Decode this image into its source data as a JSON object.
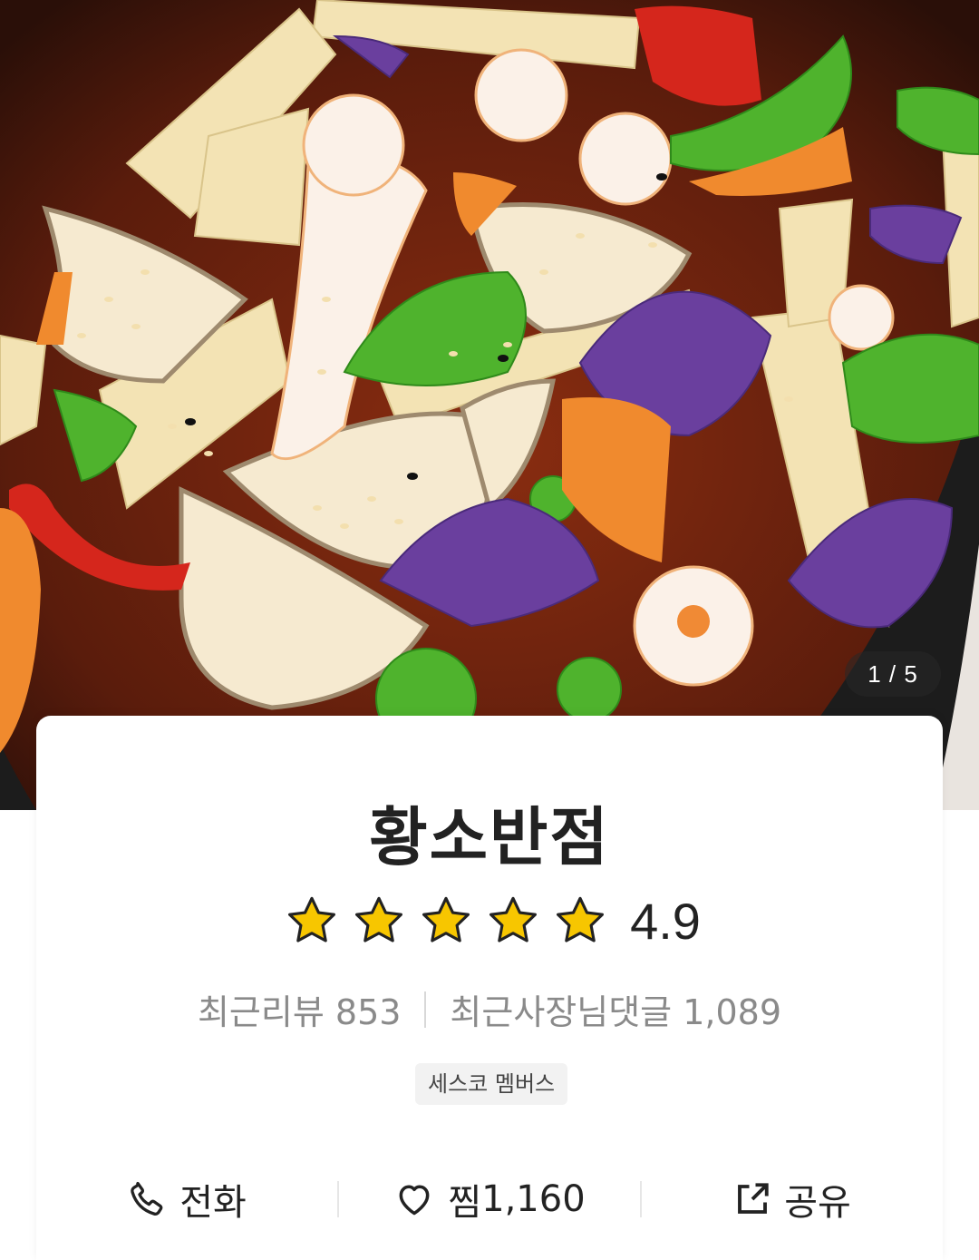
{
  "gallery": {
    "current_index": 1,
    "total": 5,
    "pager_text": "1 / 5"
  },
  "restaurant": {
    "name": "황소반점",
    "rating": 4.9,
    "rating_text": "4.9",
    "stars_filled": 5,
    "stars_total": 5,
    "recent_reviews_label": "최근리뷰 853",
    "owner_comments_label": "최근사장님댓글 1,089",
    "badge": "세스코 멤버스"
  },
  "actions": {
    "call_label": "전화",
    "like_label": "찜",
    "like_count": "1,160",
    "share_label": "공유"
  },
  "colors": {
    "star": "#f7c600",
    "text_primary": "#222222",
    "text_secondary": "#8a8a8a",
    "badge_bg": "#f2f2f2"
  }
}
